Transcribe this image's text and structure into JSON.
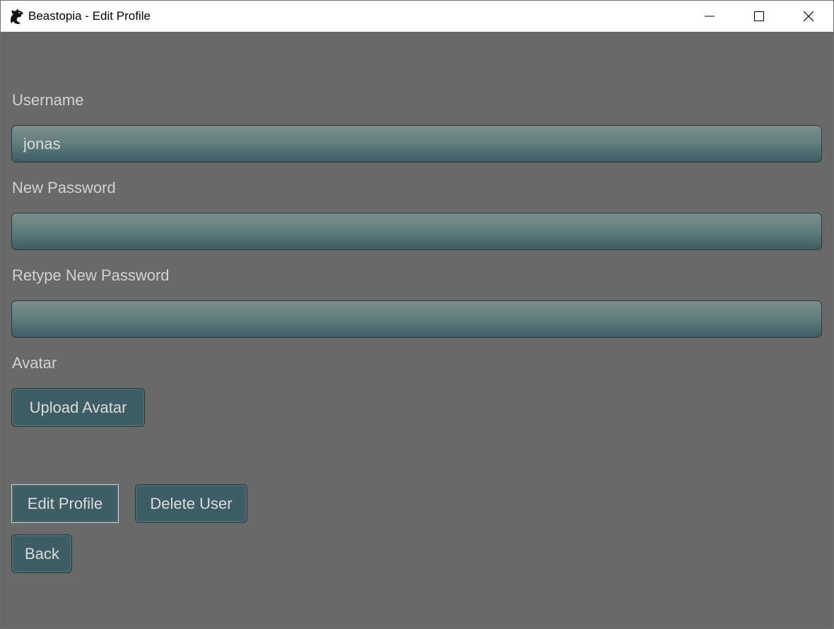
{
  "window": {
    "title": "Beastopia - Edit Profile"
  },
  "form": {
    "username_label": "Username",
    "username_value": "jonas",
    "new_password_label": "New Password",
    "new_password_value": "",
    "retype_password_label": "Retype New Password",
    "retype_password_value": "",
    "avatar_label": "Avatar",
    "upload_avatar_label": "Upload Avatar"
  },
  "actions": {
    "edit_profile_label": "Edit Profile",
    "delete_user_label": "Delete User",
    "back_label": "Back"
  },
  "colors": {
    "background": "#696969",
    "field_top": "#7e8d8a",
    "field_bottom": "#3e5d63",
    "button": "#3e5d65",
    "label_text": "#d2d2d2"
  },
  "icons": {
    "app": "dragon-icon",
    "minimize": "minimize-icon",
    "maximize": "maximize-icon",
    "close": "close-icon"
  }
}
